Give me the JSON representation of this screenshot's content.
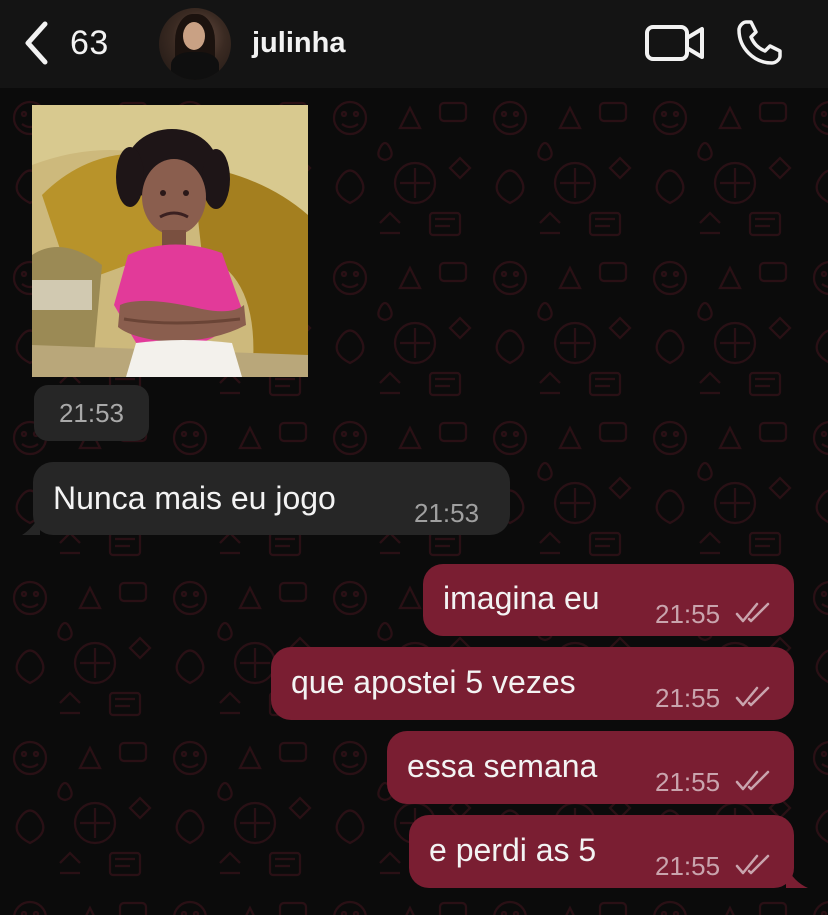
{
  "header": {
    "back_count": "63",
    "contact_name": "julinha"
  },
  "messages": [
    {
      "type": "image",
      "direction": "incoming",
      "time": "21:53",
      "icon": "photo-girl-crying"
    },
    {
      "type": "text",
      "direction": "incoming",
      "text": "Nunca mais eu jogo",
      "time": "21:53"
    },
    {
      "type": "text",
      "direction": "outgoing",
      "text": "imagina eu",
      "time": "21:55",
      "status": "read"
    },
    {
      "type": "text",
      "direction": "outgoing",
      "text": "que apostei 5 vezes",
      "time": "21:55",
      "status": "read"
    },
    {
      "type": "text",
      "direction": "outgoing",
      "text": "essa semana",
      "time": "21:55",
      "status": "read"
    },
    {
      "type": "text",
      "direction": "outgoing",
      "text": "e perdi as 5",
      "time": "21:55",
      "status": "read"
    }
  ],
  "icons": {
    "back": "chevron-left-icon",
    "video": "video-camera-icon",
    "phone": "phone-icon",
    "read_status": "double-check-icon"
  },
  "colors": {
    "header_bg": "#141414",
    "chat_bg": "#0b0b0b",
    "incoming_bubble": "#262626",
    "outgoing_bubble": "#7a1e32",
    "pattern": "#2a1015"
  }
}
